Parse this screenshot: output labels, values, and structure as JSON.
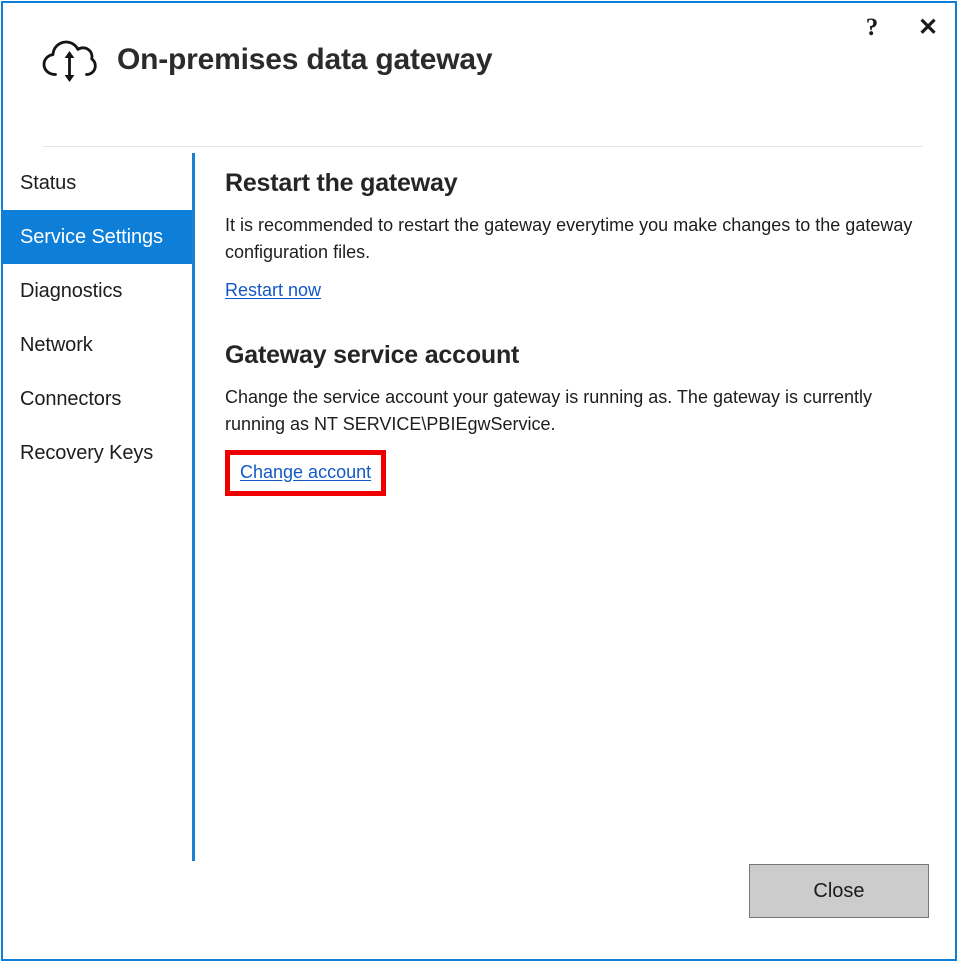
{
  "window": {
    "title": "On-premises data gateway",
    "icon": "cloud-updown-arrow-icon",
    "border_color": "#0d7fd9"
  },
  "window_controls": {
    "help_glyph": "?",
    "help_name": "help-button",
    "close_glyph": "✕",
    "close_name": "close-window-button"
  },
  "sidebar": {
    "selected": "Service Settings",
    "accent_color": "#0d7fd9",
    "items": [
      {
        "label": "Status",
        "selected": false
      },
      {
        "label": "Service Settings",
        "selected": true
      },
      {
        "label": "Diagnostics",
        "selected": false
      },
      {
        "label": "Network",
        "selected": false
      },
      {
        "label": "Connectors",
        "selected": false
      },
      {
        "label": "Recovery Keys",
        "selected": false
      }
    ]
  },
  "main": {
    "sections": [
      {
        "title": "Restart the gateway",
        "body": "It is recommended to restart the gateway everytime you make changes to the gateway configuration files.",
        "link": "Restart now",
        "highlighted": false
      },
      {
        "title": "Gateway service account",
        "body": "Change the service account your gateway is running as. The gateway is currently running as NT SERVICE\\PBIEgwService.",
        "link": "Change account",
        "highlighted": true
      }
    ]
  },
  "highlight": {
    "color": "#ef0000",
    "target": "Change account"
  },
  "footer": {
    "close_label": "Close"
  },
  "colors": {
    "link": "#1258c8",
    "accent": "#0d7fd9",
    "text": "#1d1d1d",
    "heading": "#252525",
    "divider": "#e6e6e6",
    "button_face": "#cccccc",
    "button_border": "#767676"
  }
}
